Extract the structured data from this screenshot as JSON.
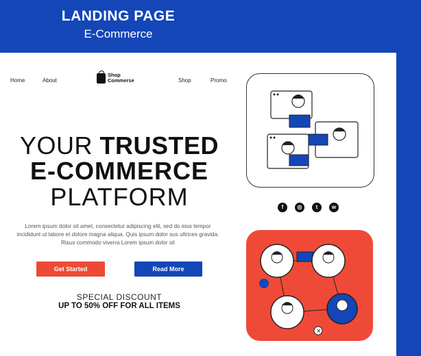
{
  "banner": {
    "title": "LANDING PAGE",
    "subtitle": "E-Commerce"
  },
  "nav": {
    "home": "Home",
    "about": "About",
    "shop": "Shop",
    "promo": "Promo"
  },
  "logo": {
    "line1": "Shop",
    "line2": "Commerse"
  },
  "hero": {
    "line1_light": "YOUR ",
    "line1_bold": "TRUSTED",
    "line2": "E-COMMERCE",
    "line3": "PLATFORM"
  },
  "description": "Lorem ipsum dolor sit amet, consectetur adipiscing elit, sed do eius tempor incididunt ut labore et dolore magna aliqua. Quis ipsum dolor sus ultrices gravida. Risus commodo viverra Lorem ipsum dolor sit",
  "buttons": {
    "start": "Get Started",
    "more": "Read More"
  },
  "discount": {
    "line1": "SPECIAL DISCOUNT",
    "line2": "UP TO 50% OFF FOR ALL ITEMS"
  },
  "socials": [
    "f",
    "◎",
    "t",
    "w"
  ],
  "icons": [
    "shopping-bag-icon",
    "facebook-icon",
    "instagram-icon",
    "twitter-icon",
    "whatsapp-icon"
  ],
  "colors": {
    "brand_blue": "#1446b8",
    "accent_red": "#ec4a35",
    "text_dark": "#111111"
  }
}
